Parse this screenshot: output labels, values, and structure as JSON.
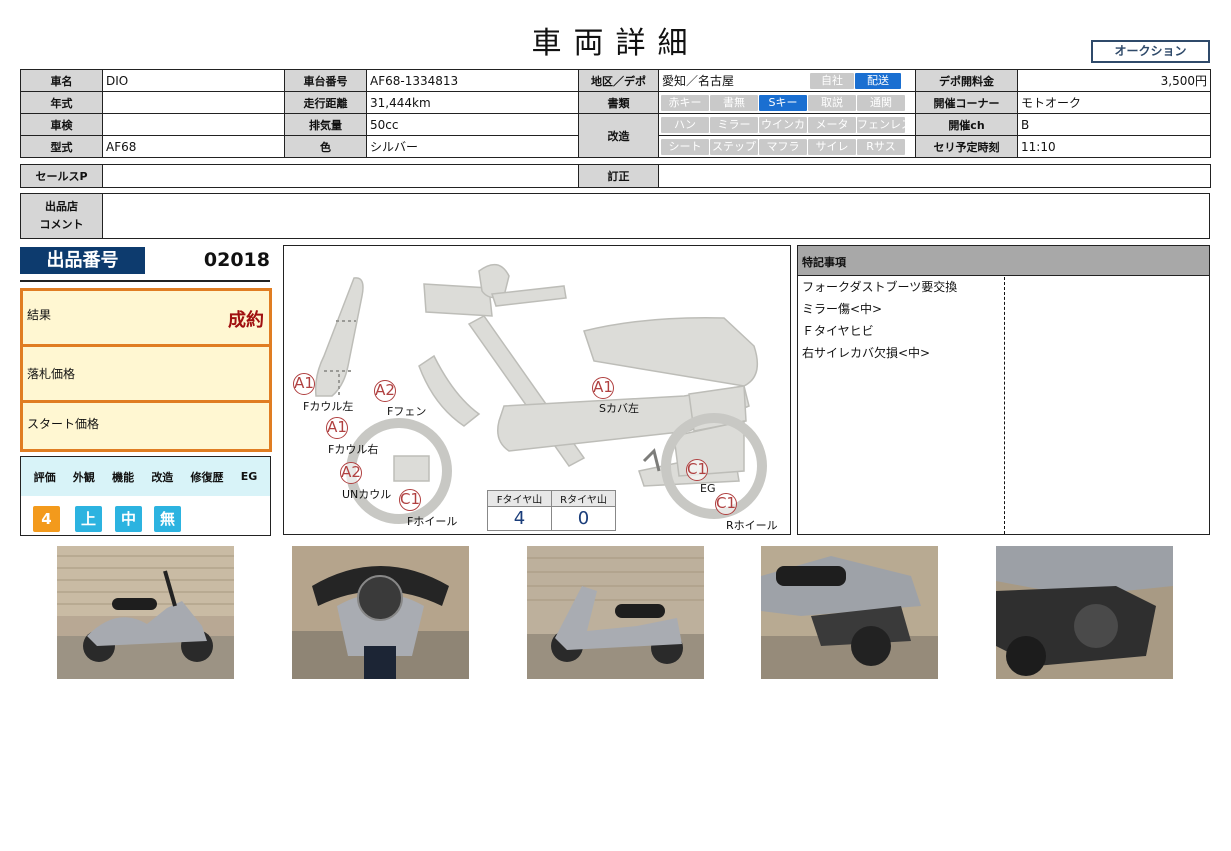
{
  "header": {
    "title": "車両詳細",
    "auction_label": "オークション"
  },
  "spec": {
    "row1": {
      "name_label": "車名",
      "name": "DIO",
      "frame_label": "車台番号",
      "frame": "AF68-1334813",
      "region_label": "地区／デポ",
      "region": "愛知／名古屋",
      "self_tag": "自社",
      "delivery_tag": "配送",
      "fee_label": "デポ開料金",
      "fee": "3,500円"
    },
    "row2": {
      "year_label": "年式",
      "year": "",
      "mileage_label": "走行距離",
      "mileage": "31,444km",
      "docs_label": "書類",
      "docs_tags": [
        "赤キー",
        "書無",
        "Sキー",
        "取説",
        "通関"
      ],
      "corner_label": "開催コーナー",
      "corner": "モトオーク"
    },
    "row3": {
      "inspection_label": "車検",
      "inspection": "",
      "displacement_label": "排気量",
      "displacement": "50cc",
      "mods_label": "改造",
      "mods_tags_1": [
        "ハン",
        "ミラー",
        "ウインカ",
        "メータ",
        "フェンレス"
      ],
      "ch_label": "開催ch",
      "ch": "B"
    },
    "row4": {
      "model_label": "型式",
      "model": "AF68",
      "color_label": "色",
      "color": "シルバー",
      "mods_tags_2": [
        "シート",
        "ステップ",
        "マフラ",
        "サイレ",
        "Rサス"
      ],
      "time_label": "セリ予定時刻",
      "time": "11:10"
    }
  },
  "sales": {
    "salespoint_label": "セールスP",
    "salespoint": "",
    "correction_label": "訂正",
    "correction": ""
  },
  "comment": {
    "label_1": "出品店",
    "label_2": "コメント",
    "text": ""
  },
  "lot": {
    "label": "出品番号",
    "number": "02018"
  },
  "result": {
    "result_label": "結果",
    "result_value": "成約",
    "hammer_label": "落札価格",
    "hammer_value": "",
    "start_label": "スタート価格",
    "start_value": ""
  },
  "evaluation": {
    "headers": [
      "評価",
      "外観",
      "機能",
      "改造",
      "修復歴",
      "EG"
    ],
    "values": [
      "4",
      "上",
      "中",
      "無"
    ],
    "colors": {
      "score": "#f39a1c",
      "grade": "#2cb3e0"
    }
  },
  "diagram": {
    "damages": [
      {
        "code": "A1",
        "part": "Fカウル左"
      },
      {
        "code": "A2",
        "part": "Fフェン"
      },
      {
        "code": "A1",
        "part": "Fカウル右"
      },
      {
        "code": "A2",
        "part": "UNカウル"
      },
      {
        "code": "C1",
        "part": "Fホイール"
      },
      {
        "code": "A1",
        "part": "Sカバ左"
      },
      {
        "code": "C1",
        "part": "EG"
      },
      {
        "code": "C1",
        "part": "Rホイール"
      }
    ],
    "tread": {
      "front_label": "Fタイヤ山",
      "front": "4",
      "rear_label": "Rタイヤ山",
      "rear": "0"
    }
  },
  "notes": {
    "title": "特記事項",
    "lines": [
      "フォークダストブーツ要交換",
      "ミラー傷<中>",
      "Ｆタイヤヒビ",
      "右サイレカバ欠損<中>"
    ]
  },
  "photos": [
    "left-side-view",
    "handlebar-meter-view",
    "left-side-view-2",
    "right-rear-view",
    "engine-closeup"
  ]
}
